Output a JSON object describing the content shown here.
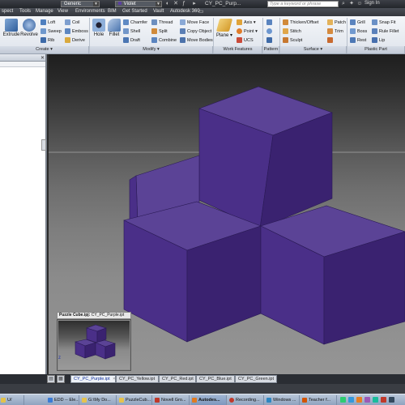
{
  "titlebar": {
    "material": "Generic",
    "appearance": "Violet",
    "title": "CY_PC_Purp...",
    "search_placeholder": "Type a keyword or phrase",
    "sign_in": "Sign In"
  },
  "menu": {
    "items": [
      "spect",
      "Tools",
      "Manage",
      "View",
      "Environments",
      "BIM",
      "Get Started",
      "Vault",
      "Autodesk 360"
    ]
  },
  "ribbon": {
    "create": {
      "extrude": "Extrude",
      "revolve": "Revolve",
      "loft": "Loft",
      "sweep": "Sweep",
      "rib": "Rib",
      "coil": "Coil",
      "emboss": "Emboss",
      "derive": "Derive",
      "label": "Create"
    },
    "modify": {
      "hole": "Hole",
      "fillet": "Fillet",
      "chamfer": "Chamfer",
      "shell": "Shell",
      "draft": "Draft",
      "thread": "Thread",
      "split": "Split",
      "combine": "Combine",
      "move_face": "Move Face",
      "copy_object": "Copy Object",
      "move_bodies": "Move Bodies",
      "label": "Modify"
    },
    "work_features": {
      "plane": "Plane",
      "axis": "Axis",
      "point": "Point",
      "ucs": "UCS",
      "label": "Work Features"
    },
    "pattern": {
      "label": "Pattern"
    },
    "surface": {
      "thicken": "Thicken/Offset",
      "stitch": "Stitch",
      "sculpt": "Sculpt",
      "patch": "Patch",
      "trim": "Trim",
      "label": "Surface"
    },
    "plastic": {
      "grill": "Grill",
      "boss": "Boss",
      "rest": "Rest",
      "snap_fit": "Snap Fit",
      "rule_fillet": "Rule Fillet",
      "lip": "Lip",
      "label": "Plastic Part"
    }
  },
  "thumbnail": {
    "title_bold": "Puzzle Cube.ipj:",
    "title_file": "CY_PC_Purple.ipt",
    "axis": "z"
  },
  "doctabs": {
    "tabs": [
      "CY_PC_Purple.ipt",
      "CY_PC_Yellow.ipt",
      "CY_PC_Red.ipt",
      "CY_PC_Blue.ipt",
      "CY_PC_Green.ipt"
    ],
    "close": "×"
  },
  "taskbar": {
    "items": [
      "U/",
      "EDD -- Ele...",
      "G:\\My Do...",
      "PuzzleCub...",
      "Novell Gro...",
      "Autodes...",
      "Recording...",
      "Windows ...",
      "Teacher f..."
    ]
  },
  "colors": {
    "cube_top": "#5b4396",
    "cube_left": "#4a2f88",
    "cube_right": "#3a2270"
  }
}
